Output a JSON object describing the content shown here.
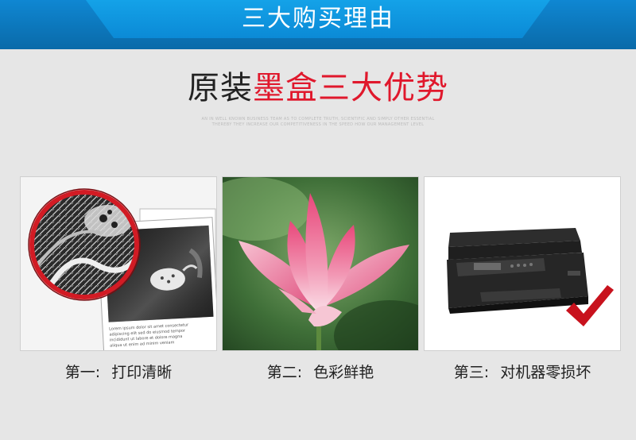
{
  "banner": {
    "title": "三大购买理由"
  },
  "headline": {
    "part_black": "原装",
    "part_red": "墨盒三大优势"
  },
  "fine_print": {
    "line1": "AN IN WELL KNOWN BUSINESS TEAM AS TO COMPLETE TRUTH, SCIENTIFIC AND SIMPLY OTHER ESSENTIAL",
    "line2": "THEREBY THEY INCREASE OUR COMPETITIVENESS IN THE SPEED HOW OUR MANAGEMENT LEVEL"
  },
  "photo_text": {
    "intro": "Lorem ipsum dolor sit amet consectetur adipiscing elit sed do eiusmod tempor incididunt ut labore et dolore magna aliqua"
  },
  "reasons": [
    {
      "prefix": "第一:",
      "text": "打印清晰"
    },
    {
      "prefix": "第二:",
      "text": "色彩鲜艳"
    },
    {
      "prefix": "第三:",
      "text": "对机器零损坏"
    }
  ],
  "colors": {
    "banner": "#0d7cc4",
    "tab": "#14a2e8",
    "accent_red": "#e0182c",
    "check": "#c8121d",
    "background": "#e6e6e6"
  },
  "icons": {
    "check": "check-icon"
  }
}
